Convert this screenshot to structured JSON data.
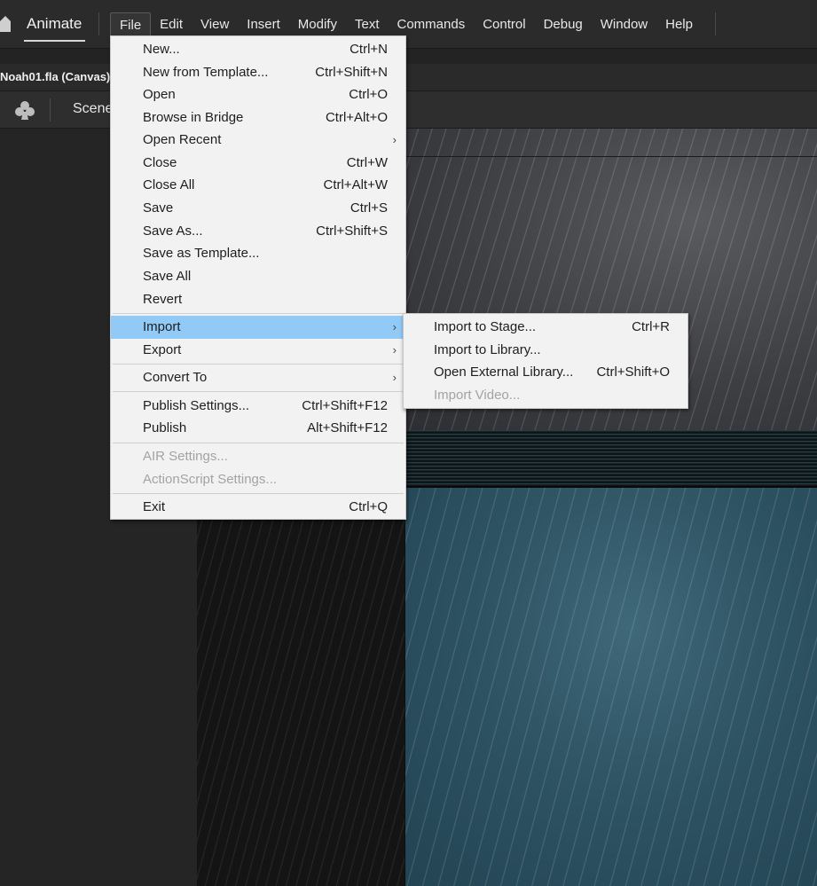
{
  "app": {
    "name": "Animate"
  },
  "menubar": {
    "items": [
      "File",
      "Edit",
      "View",
      "Insert",
      "Modify",
      "Text",
      "Commands",
      "Control",
      "Debug",
      "Window",
      "Help"
    ],
    "active": "File"
  },
  "document": {
    "tab_title": "Noah01.fla (Canvas)"
  },
  "editbar": {
    "scene_label": "Scene"
  },
  "file_menu": {
    "items": [
      {
        "label": "New...",
        "shortcut": "Ctrl+N"
      },
      {
        "label": "New from Template...",
        "shortcut": "Ctrl+Shift+N"
      },
      {
        "label": "Open",
        "shortcut": "Ctrl+O"
      },
      {
        "label": "Browse in Bridge",
        "shortcut": "Ctrl+Alt+O"
      },
      {
        "label": "Open Recent",
        "shortcut": ""
      },
      {
        "label": "Close",
        "shortcut": "Ctrl+W"
      },
      {
        "label": "Close All",
        "shortcut": "Ctrl+Alt+W"
      },
      {
        "label": "Save",
        "shortcut": "Ctrl+S"
      },
      {
        "label": "Save As...",
        "shortcut": "Ctrl+Shift+S"
      },
      {
        "label": "Save as Template...",
        "shortcut": ""
      },
      {
        "label": "Save All",
        "shortcut": ""
      },
      {
        "label": "Revert",
        "shortcut": ""
      },
      {
        "label": "Import",
        "shortcut": ""
      },
      {
        "label": "Export",
        "shortcut": ""
      },
      {
        "label": "Convert To",
        "shortcut": ""
      },
      {
        "label": "Publish Settings...",
        "shortcut": "Ctrl+Shift+F12"
      },
      {
        "label": "Publish",
        "shortcut": "Alt+Shift+F12"
      },
      {
        "label": "AIR Settings...",
        "shortcut": ""
      },
      {
        "label": "ActionScript Settings...",
        "shortcut": ""
      },
      {
        "label": "Exit",
        "shortcut": "Ctrl+Q"
      }
    ]
  },
  "import_submenu": {
    "items": [
      {
        "label": "Import to Stage...",
        "shortcut": "Ctrl+R"
      },
      {
        "label": "Import to Library...",
        "shortcut": ""
      },
      {
        "label": "Open External Library...",
        "shortcut": "Ctrl+Shift+O"
      },
      {
        "label": "Import Video...",
        "shortcut": ""
      }
    ]
  },
  "colors": {
    "menubar_bg": "#2b2b2b",
    "menu_bg": "#f2f2f2",
    "highlight": "#91c9f7",
    "disabled_text": "#a3a3a3"
  },
  "icons": {
    "home": "home-icon",
    "scene": "club-icon",
    "submenu": "chevron-right-icon"
  }
}
